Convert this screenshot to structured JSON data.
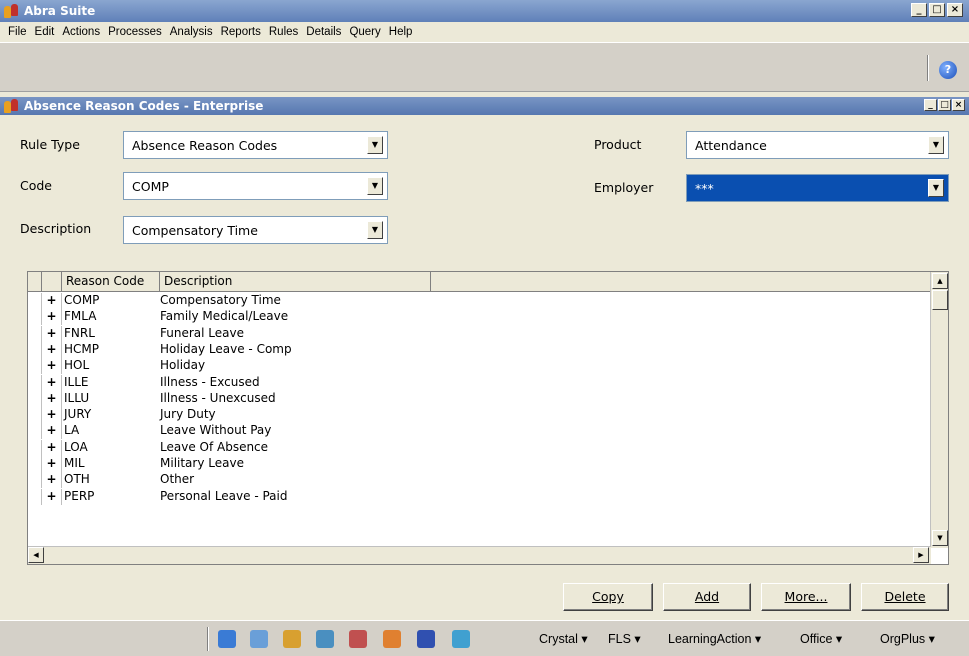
{
  "app": {
    "title": "Abra Suite",
    "menu": [
      "File",
      "Edit",
      "Actions",
      "Processes",
      "Analysis",
      "Reports",
      "Rules",
      "Details",
      "Query",
      "Help"
    ]
  },
  "window": {
    "title": "Absence Reason Codes - Enterprise"
  },
  "form": {
    "rule_type_label": "Rule Type",
    "rule_type_value": "Absence Reason Codes",
    "code_label": "Code",
    "code_value": "COMP",
    "description_label": "Description",
    "description_value": "Compensatory Time",
    "product_label": "Product",
    "product_value": "Attendance",
    "employer_label": "Employer",
    "employer_value": "***"
  },
  "grid": {
    "columns": [
      "Reason Code",
      "Description"
    ],
    "rows": [
      {
        "code": "COMP",
        "description": "Compensatory Time"
      },
      {
        "code": "FMLA",
        "description": "Family Medical/Leave"
      },
      {
        "code": "FNRL",
        "description": "Funeral Leave"
      },
      {
        "code": "HCMP",
        "description": "Holiday Leave - Comp"
      },
      {
        "code": "HOL",
        "description": "Holiday"
      },
      {
        "code": "ILLE",
        "description": "Illness - Excused"
      },
      {
        "code": "ILLU",
        "description": "Illness - Unexcused"
      },
      {
        "code": "JURY",
        "description": "Jury Duty"
      },
      {
        "code": "LA",
        "description": "Leave Without Pay"
      },
      {
        "code": "LOA",
        "description": "Leave Of Absence"
      },
      {
        "code": "MIL",
        "description": "Military Leave"
      },
      {
        "code": "OTH",
        "description": "Other"
      },
      {
        "code": "PERP",
        "description": "Personal Leave - Paid"
      }
    ],
    "expand_glyph": "+"
  },
  "buttons": {
    "copy": "Copy",
    "add": "Add",
    "more": "More...",
    "delete": "Delete"
  },
  "taskbar": {
    "icons": [
      "refresh-icon",
      "document-icon",
      "people-icon",
      "group-icon",
      "report-icon",
      "person-icon",
      "checklist-icon",
      "chat-icon"
    ],
    "menus": [
      "Crystal ▾",
      "FLS ▾",
      "LearningAction ▾",
      "Office ▾",
      "OrgPlus ▾"
    ]
  },
  "colors": {
    "title_bar": "#6a88be",
    "selected_field": "#0a4fb0"
  }
}
